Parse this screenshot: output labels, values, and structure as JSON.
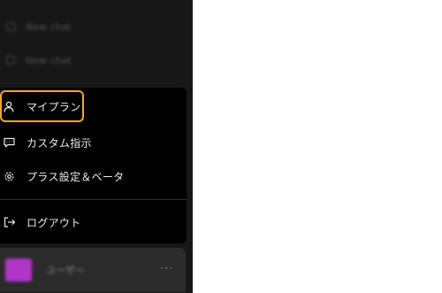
{
  "history": {
    "items": [
      {
        "label": "New chat"
      },
      {
        "label": "New chat"
      }
    ]
  },
  "menu": {
    "items": [
      {
        "id": "my-plan",
        "label": "マイプラン",
        "icon": "user-icon"
      },
      {
        "id": "custom-instructions",
        "label": "カスタム指示",
        "icon": "chat-icon"
      },
      {
        "id": "settings-beta",
        "label": "プラス設定＆ベータ",
        "icon": "gear-icon"
      },
      {
        "id": "logout",
        "label": "ログアウト",
        "icon": "logout-icon"
      }
    ]
  },
  "user": {
    "name": "ユーザー",
    "more": "···"
  },
  "colors": {
    "sidebar_bg": "#171717",
    "menu_bg": "#000000",
    "highlight": "#f5a623",
    "avatar": "#b036c8"
  }
}
